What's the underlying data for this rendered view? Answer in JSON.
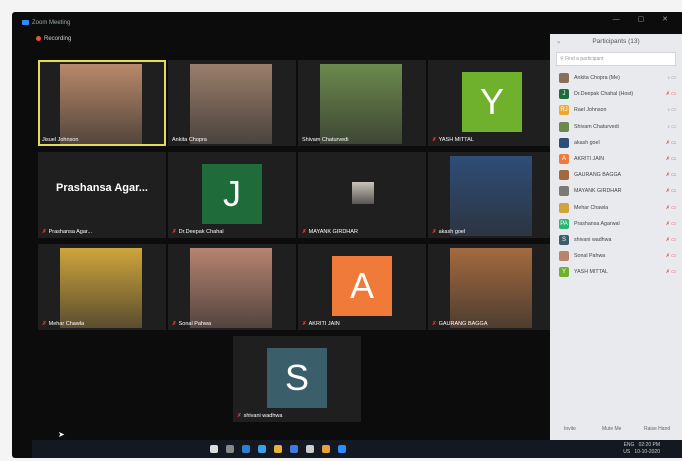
{
  "window": {
    "title": "Zoom Meeting",
    "recording_label": "Recording"
  },
  "gallery": [
    {
      "name": "Jisuel Johnson",
      "type": "video",
      "muted": false,
      "active": true,
      "tone": "#b9896a"
    },
    {
      "name": "Ankita Chopra",
      "type": "video",
      "muted": false,
      "active": false,
      "tone": "#9b7e6b"
    },
    {
      "name": "Shivam Chaturvedi",
      "type": "video",
      "muted": false,
      "active": false,
      "tone": "#6c8a4d"
    },
    {
      "name": "YASH MITTAL",
      "type": "avatar",
      "letter": "Y",
      "color": "#6fb02c",
      "muted": true
    },
    {
      "name": "Prashansa Agar...",
      "type": "name",
      "muted": true
    },
    {
      "name": "Dr.Deepak Chahal",
      "type": "avatar",
      "letter": "J",
      "color": "#1f6b3a",
      "muted": true
    },
    {
      "name": "MAYANK GIRDHAR",
      "type": "photo",
      "muted": true,
      "tone": "#c9c3b8"
    },
    {
      "name": "akash goel",
      "type": "video",
      "muted": true,
      "tone": "#2f4d78"
    },
    {
      "name": "Mehar Chawla",
      "type": "video",
      "muted": true,
      "tone": "#cfa53b"
    },
    {
      "name": "Sonal Pahwa",
      "type": "video",
      "muted": true,
      "tone": "#b78470"
    },
    {
      "name": "AKRITI JAIN",
      "type": "avatar",
      "letter": "A",
      "color": "#f07a3a",
      "muted": true
    },
    {
      "name": "GAURANG BAGGA",
      "type": "video",
      "muted": true,
      "tone": "#a46a3f"
    },
    {
      "name": "shivani wadhwa",
      "type": "avatar",
      "letter": "S",
      "color": "#3a5e6a",
      "muted": true
    }
  ],
  "participants_panel": {
    "title": "Participants (13)",
    "search_placeholder": "Find a participant",
    "items": [
      {
        "name": "Ankita Chopra (Me)",
        "color": "#8a6e5c",
        "initial": "",
        "muted": false
      },
      {
        "name": "Dr.Deepak Chahal (Host)",
        "color": "#1f6b3a",
        "initial": "J",
        "muted": true
      },
      {
        "name": "Rael Johnson",
        "color": "#f0a830",
        "initial": "RJ",
        "muted": false
      },
      {
        "name": "Shivam Chaturvedi",
        "color": "#6c8a4d",
        "initial": "",
        "muted": false
      },
      {
        "name": "akash goel",
        "color": "#2f4d78",
        "initial": "",
        "muted": true
      },
      {
        "name": "AKRITI JAIN",
        "color": "#f07a3a",
        "initial": "A",
        "muted": true
      },
      {
        "name": "GAURANG BAGGA",
        "color": "#a46a3f",
        "initial": "",
        "muted": true
      },
      {
        "name": "MAYANK GIRDHAR",
        "color": "#7d7a74",
        "initial": "",
        "muted": true
      },
      {
        "name": "Mehar Chawla",
        "color": "#cfa53b",
        "initial": "",
        "muted": true
      },
      {
        "name": "Prashansa Agarwal",
        "color": "#2bb673",
        "initial": "PA",
        "muted": true
      },
      {
        "name": "shivani wadhwa",
        "color": "#3a5e6a",
        "initial": "S",
        "muted": true
      },
      {
        "name": "Sonal Pahwa",
        "color": "#b78470",
        "initial": "",
        "muted": true
      },
      {
        "name": "YASH MITTAL",
        "color": "#6fb02c",
        "initial": "Y",
        "muted": true
      }
    ],
    "footer": {
      "invite": "Invite",
      "mute_me": "Mute Me",
      "raise_hand": "Raise Hand"
    }
  },
  "taskbar": {
    "lang": "ENG",
    "region": "US",
    "time": "02:20 PM",
    "date": "10-10-2020"
  }
}
